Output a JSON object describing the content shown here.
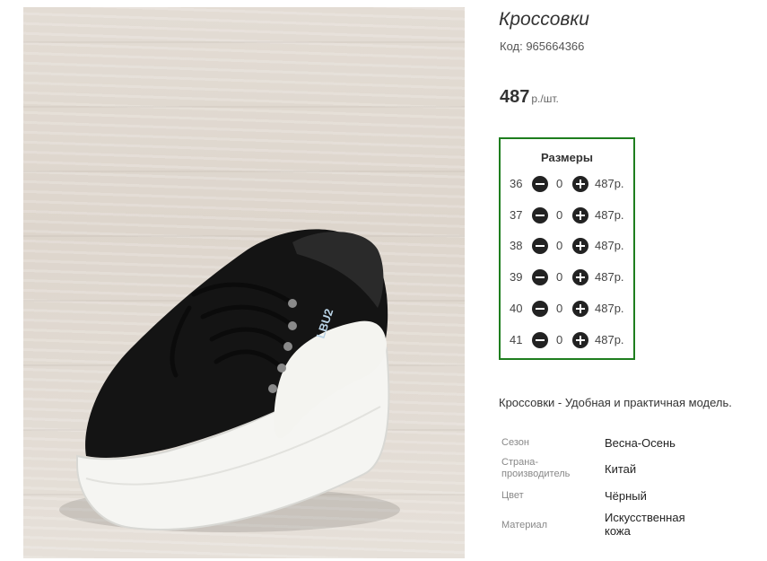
{
  "product": {
    "title": "Кроссовки",
    "code": "Код: 965664366",
    "price": "487",
    "price_unit": "р./шт.",
    "description": "Кроссовки - Удобная и практичная модель.",
    "image_alt": "black-white-sneaker-photo",
    "shoe_print": "LBU2"
  },
  "sizes": {
    "title": "Размеры",
    "rows": [
      {
        "size": "36",
        "qty": "0",
        "price": "487р."
      },
      {
        "size": "37",
        "qty": "0",
        "price": "487р."
      },
      {
        "size": "38",
        "qty": "0",
        "price": "487р."
      },
      {
        "size": "39",
        "qty": "0",
        "price": "487р."
      },
      {
        "size": "40",
        "qty": "0",
        "price": "487р."
      },
      {
        "size": "41",
        "qty": "0",
        "price": "487р."
      }
    ]
  },
  "properties": [
    {
      "key": "Сезон",
      "value": "Весна-Осень"
    },
    {
      "key": "Страна-производитель",
      "value": "Китай"
    },
    {
      "key": "Цвет",
      "value": "Чёрный"
    },
    {
      "key": "Материал",
      "value": "Искусственная кожа"
    }
  ],
  "colors": {
    "border_accent": "#1e7e1e",
    "button_dark": "#222222"
  }
}
